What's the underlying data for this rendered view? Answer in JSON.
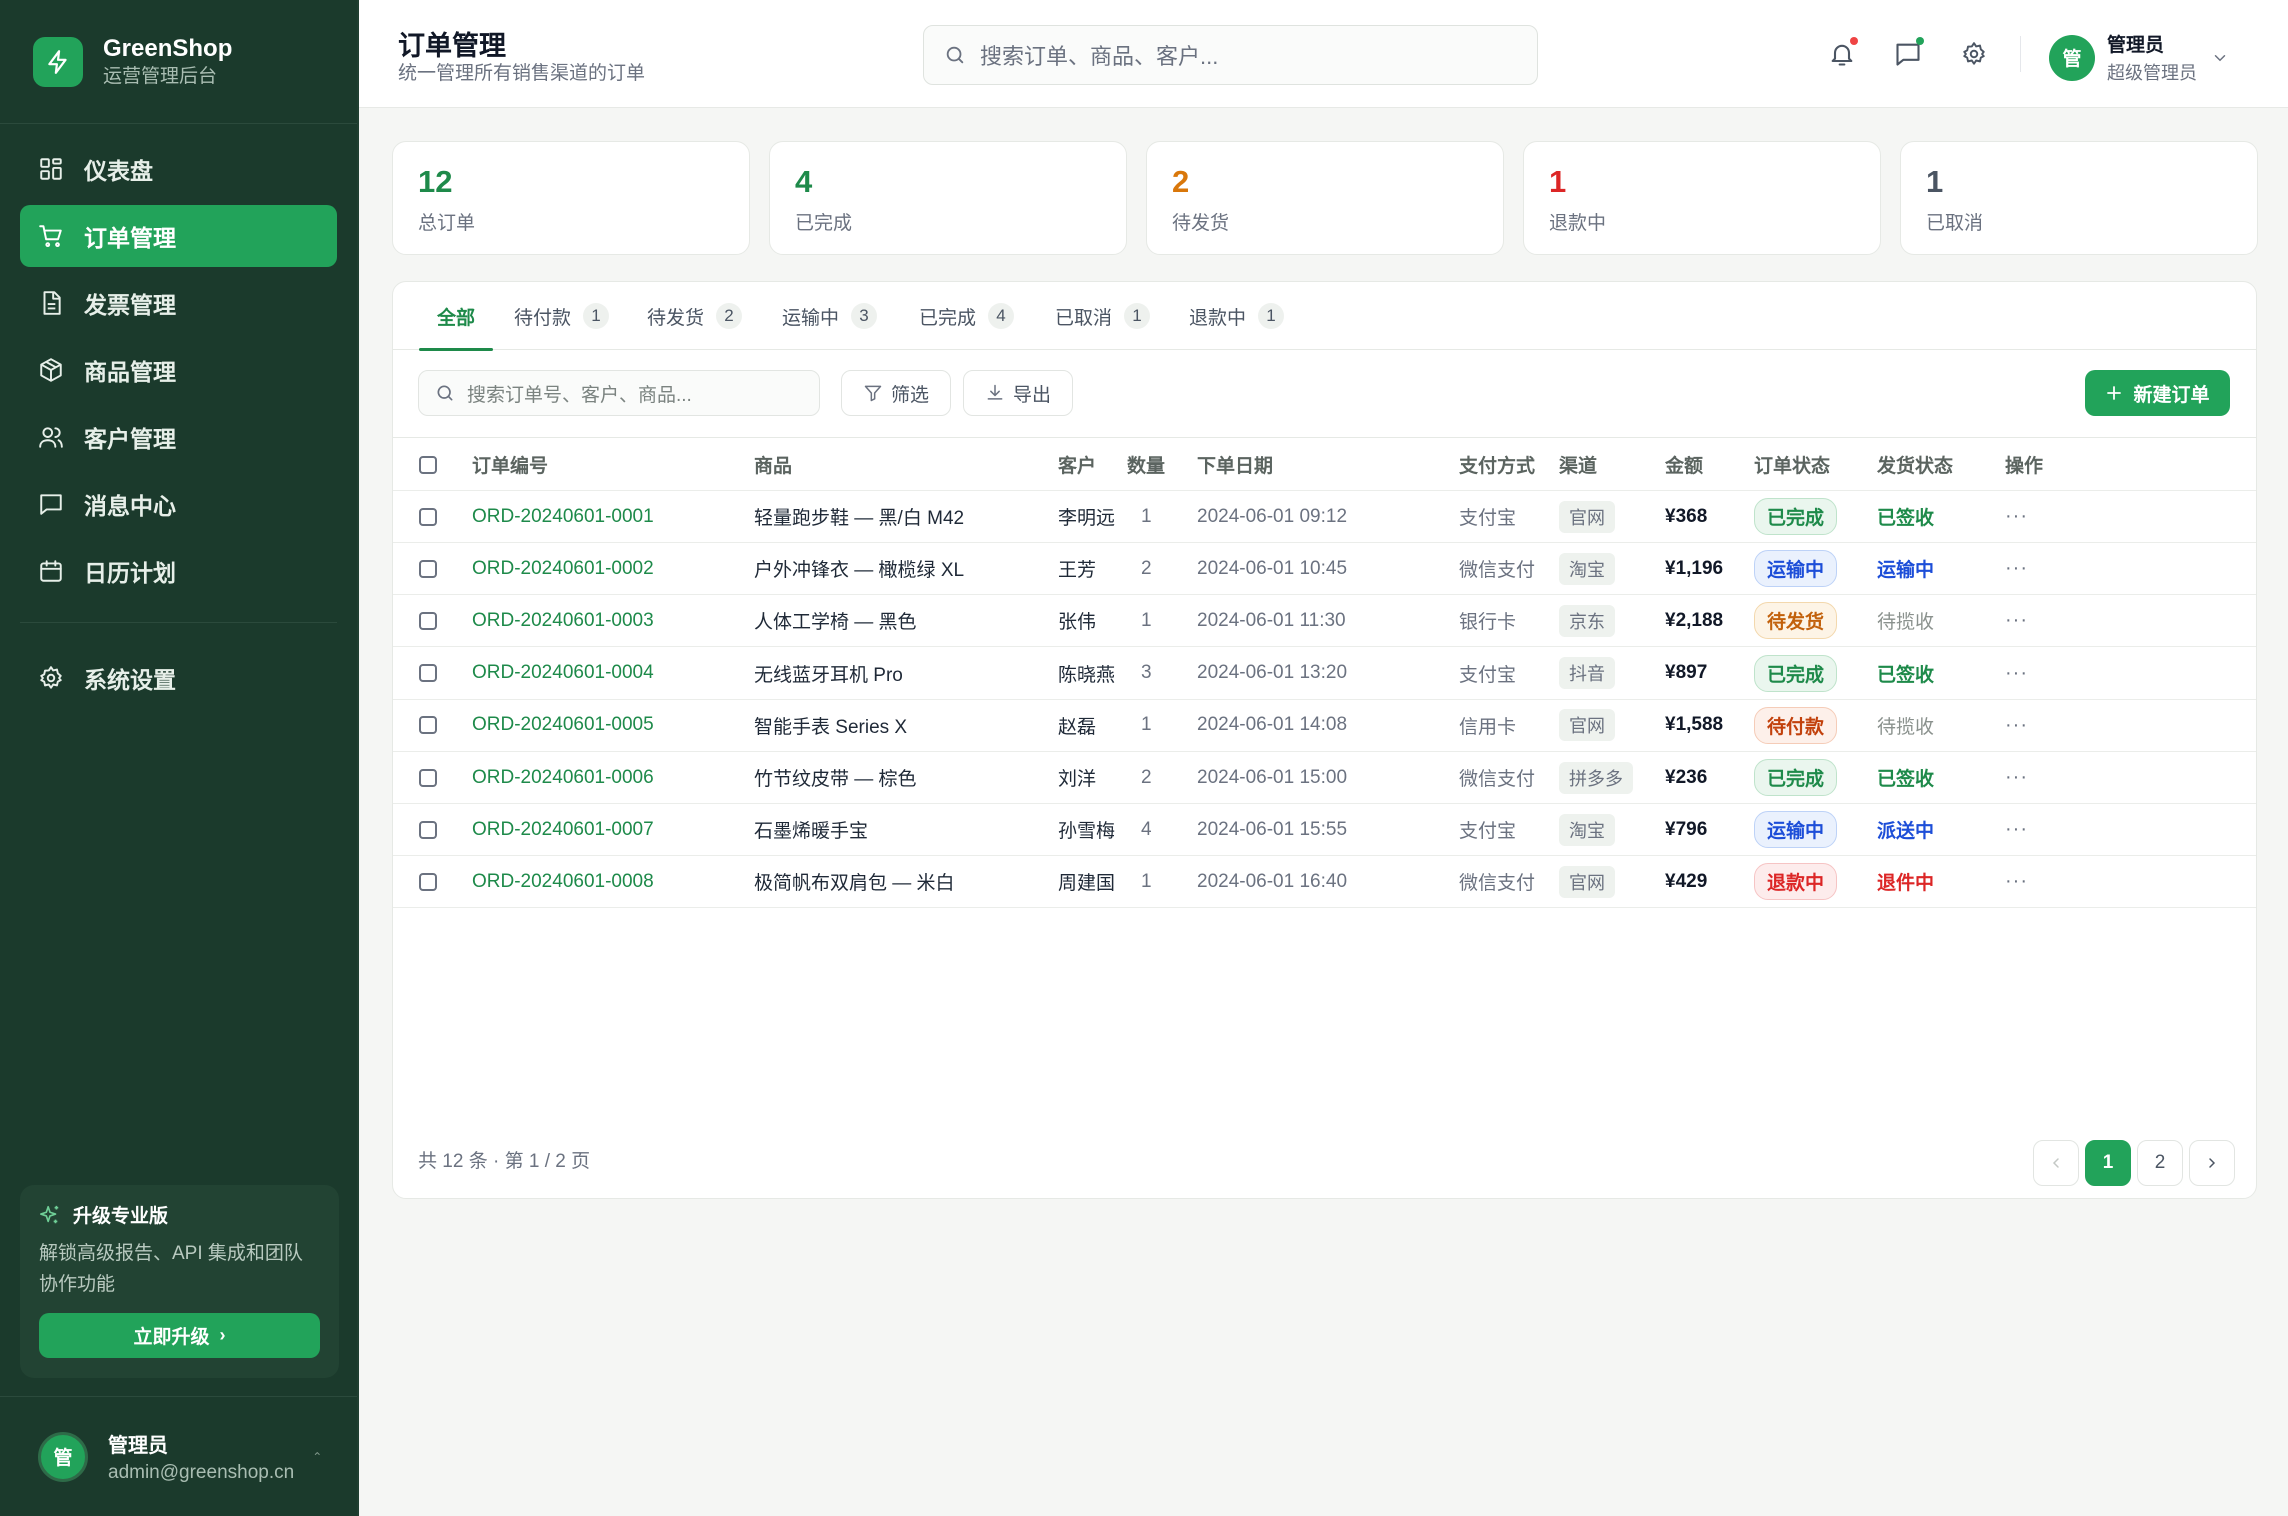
{
  "app": {
    "name": "GreenShop",
    "subtitle": "运营管理后台"
  },
  "sidebar": {
    "items": [
      {
        "label": "仪表盘",
        "icon": "dashboard-icon"
      },
      {
        "label": "订单管理",
        "icon": "cart-icon",
        "active": true
      },
      {
        "label": "发票管理",
        "icon": "invoice-icon"
      },
      {
        "label": "商品管理",
        "icon": "box-icon"
      },
      {
        "label": "客户管理",
        "icon": "users-icon"
      },
      {
        "label": "消息中心",
        "icon": "message-icon"
      },
      {
        "label": "日历计划",
        "icon": "calendar-icon"
      }
    ],
    "settings": {
      "label": "系统设置",
      "icon": "gear-icon"
    },
    "upgrade": {
      "title": "升级专业版",
      "desc": "解锁高级报告、API 集成和团队协作功能",
      "button": "立即升级"
    },
    "user": {
      "avatar": "管",
      "name": "管理员",
      "email": "admin@greenshop.cn"
    }
  },
  "header": {
    "title": "订单管理",
    "subtitle": "统一管理所有销售渠道的订单",
    "search_placeholder": "搜索订单、商品、客户...",
    "user": {
      "avatar": "管",
      "name": "管理员",
      "role": "超级管理员"
    }
  },
  "stats": [
    {
      "value": "12",
      "label": "总订单",
      "color": "#1e8a4a"
    },
    {
      "value": "4",
      "label": "已完成",
      "color": "#1e8a4a"
    },
    {
      "value": "2",
      "label": "待发货",
      "color": "#d9770a"
    },
    {
      "value": "1",
      "label": "退款中",
      "color": "#dc2626"
    },
    {
      "value": "1",
      "label": "已取消",
      "color": "#4b5563"
    }
  ],
  "tabs": [
    {
      "label": "全部",
      "count": ""
    },
    {
      "label": "待付款",
      "count": "1"
    },
    {
      "label": "待发货",
      "count": "2"
    },
    {
      "label": "运输中",
      "count": "3"
    },
    {
      "label": "已完成",
      "count": "4"
    },
    {
      "label": "已取消",
      "count": "1"
    },
    {
      "label": "退款中",
      "count": "1"
    }
  ],
  "toolbar": {
    "search_placeholder": "搜索订单号、客户、商品...",
    "filter": "筛选",
    "export": "导出",
    "new_order": "新建订单"
  },
  "table": {
    "columns": [
      "订单编号",
      "商品",
      "客户",
      "数量",
      "下单日期",
      "支付方式",
      "渠道",
      "金额",
      "订单状态",
      "发货状态",
      "操作"
    ],
    "rows": [
      {
        "id": "ORD-20240601-0001",
        "product": "轻量跑步鞋 — 黑/白 M42",
        "customer": "李明远",
        "qty": "1",
        "date": "2024-06-01 09:12",
        "pay": "支付宝",
        "channel": "官网",
        "amount": "¥368",
        "status": "已完成",
        "ship": "已签收"
      },
      {
        "id": "ORD-20240601-0002",
        "product": "户外冲锋衣 — 橄榄绿 XL",
        "customer": "王芳",
        "qty": "2",
        "date": "2024-06-01 10:45",
        "pay": "微信支付",
        "channel": "淘宝",
        "amount": "¥1,196",
        "status": "运输中",
        "ship": "运输中"
      },
      {
        "id": "ORD-20240601-0003",
        "product": "人体工学椅 — 黑色",
        "customer": "张伟",
        "qty": "1",
        "date": "2024-06-01 11:30",
        "pay": "银行卡",
        "channel": "京东",
        "amount": "¥2,188",
        "status": "待发货",
        "ship": "待揽收"
      },
      {
        "id": "ORD-20240601-0004",
        "product": "无线蓝牙耳机 Pro",
        "customer": "陈晓燕",
        "qty": "3",
        "date": "2024-06-01 13:20",
        "pay": "支付宝",
        "channel": "抖音",
        "amount": "¥897",
        "status": "已完成",
        "ship": "已签收"
      },
      {
        "id": "ORD-20240601-0005",
        "product": "智能手表 Series X",
        "customer": "赵磊",
        "qty": "1",
        "date": "2024-06-01 14:08",
        "pay": "信用卡",
        "channel": "官网",
        "amount": "¥1,588",
        "status": "待付款",
        "ship": "待揽收"
      },
      {
        "id": "ORD-20240601-0006",
        "product": "竹节纹皮带 — 棕色",
        "customer": "刘洋",
        "qty": "2",
        "date": "2024-06-01 15:00",
        "pay": "微信支付",
        "channel": "拼多多",
        "amount": "¥236",
        "status": "已完成",
        "ship": "已签收"
      },
      {
        "id": "ORD-20240601-0007",
        "product": "石墨烯暖手宝",
        "customer": "孙雪梅",
        "qty": "4",
        "date": "2024-06-01 15:55",
        "pay": "支付宝",
        "channel": "淘宝",
        "amount": "¥796",
        "status": "运输中",
        "ship": "派送中"
      },
      {
        "id": "ORD-20240601-0008",
        "product": "极简帆布双肩包 — 米白",
        "customer": "周建国",
        "qty": "1",
        "date": "2024-06-01 16:40",
        "pay": "微信支付",
        "channel": "官网",
        "amount": "¥429",
        "status": "退款中",
        "ship": "退件中"
      }
    ]
  },
  "pagination": {
    "summary": "共 12 条 · 第 1 / 2 页",
    "pages": [
      "1",
      "2"
    ],
    "current": "1"
  },
  "colors": {
    "brand": "#22a35a",
    "sidebar": "#1b3a2c"
  }
}
